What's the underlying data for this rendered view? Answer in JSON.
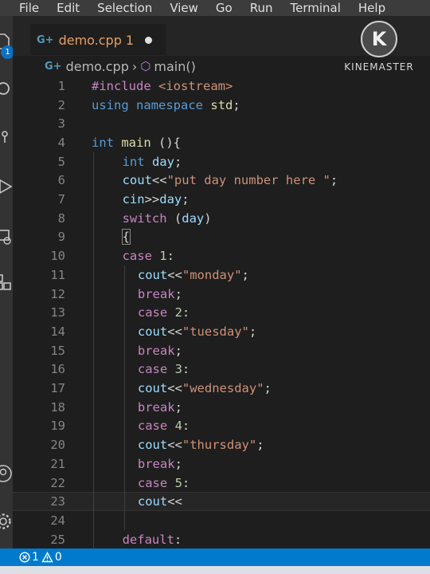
{
  "menu": [
    "File",
    "Edit",
    "Selection",
    "View",
    "Go",
    "Run",
    "Terminal",
    "Help"
  ],
  "tab": {
    "filename": "demo.cpp",
    "modified_count": "1"
  },
  "breadcrumb": {
    "file": "demo.cpp",
    "symbol": "main()"
  },
  "activity": {
    "badge": "1"
  },
  "watermark": {
    "letter": "K",
    "text": "KINEMASTER"
  },
  "status": {
    "errors": "1",
    "warnings": "0"
  },
  "editor": {
    "current_line": 23,
    "lines": [
      {
        "n": "1",
        "indent": 0,
        "tokens": [
          [
            "pp",
            "#include "
          ],
          [
            "inc",
            "<iostream>"
          ]
        ]
      },
      {
        "n": "2",
        "indent": 0,
        "tokens": [
          [
            "kw",
            "using"
          ],
          [
            "plain",
            " "
          ],
          [
            "kw",
            "namespace"
          ],
          [
            "plain",
            " "
          ],
          [
            "fn",
            "std"
          ],
          [
            "plain",
            ";"
          ]
        ]
      },
      {
        "n": "3",
        "indent": 0,
        "tokens": []
      },
      {
        "n": "4",
        "indent": 0,
        "tokens": [
          [
            "kw",
            "int"
          ],
          [
            "plain",
            " "
          ],
          [
            "fn",
            "main"
          ],
          [
            "plain",
            " (){"
          ]
        ]
      },
      {
        "n": "5",
        "indent": 2,
        "tokens": [
          [
            "kw",
            "int"
          ],
          [
            "plain",
            " "
          ],
          [
            "id",
            "day"
          ],
          [
            "plain",
            ";"
          ]
        ]
      },
      {
        "n": "6",
        "indent": 2,
        "tokens": [
          [
            "id",
            "cout"
          ],
          [
            "plain",
            "<<"
          ],
          [
            "str",
            "\"put day number here \""
          ],
          [
            "plain",
            ";"
          ]
        ]
      },
      {
        "n": "7",
        "indent": 2,
        "tokens": [
          [
            "id",
            "cin"
          ],
          [
            "plain",
            ">>"
          ],
          [
            "id",
            "day"
          ],
          [
            "plain",
            ";"
          ]
        ]
      },
      {
        "n": "8",
        "indent": 2,
        "tokens": [
          [
            "ctl",
            "switch"
          ],
          [
            "plain",
            " ("
          ],
          [
            "id",
            "day"
          ],
          [
            "plain",
            ")"
          ]
        ]
      },
      {
        "n": "9",
        "indent": 2,
        "tokens": [
          [
            "plain",
            "{"
          ]
        ]
      },
      {
        "n": "10",
        "indent": 2,
        "tokens": [
          [
            "ctl",
            "case"
          ],
          [
            "plain",
            " "
          ],
          [
            "num",
            "1"
          ],
          [
            "plain",
            ":"
          ]
        ]
      },
      {
        "n": "11",
        "indent": 3,
        "tokens": [
          [
            "id",
            "cout"
          ],
          [
            "plain",
            "<<"
          ],
          [
            "str",
            "\"monday\""
          ],
          [
            "plain",
            ";"
          ]
        ]
      },
      {
        "n": "12",
        "indent": 3,
        "tokens": [
          [
            "ctl",
            "break"
          ],
          [
            "plain",
            ";"
          ]
        ]
      },
      {
        "n": "13",
        "indent": 3,
        "tokens": [
          [
            "ctl",
            "case"
          ],
          [
            "plain",
            " "
          ],
          [
            "num",
            "2"
          ],
          [
            "plain",
            ":"
          ]
        ]
      },
      {
        "n": "14",
        "indent": 3,
        "tokens": [
          [
            "id",
            "cout"
          ],
          [
            "plain",
            "<<"
          ],
          [
            "str",
            "\"tuesday\""
          ],
          [
            "plain",
            ";"
          ]
        ]
      },
      {
        "n": "15",
        "indent": 3,
        "tokens": [
          [
            "ctl",
            "break"
          ],
          [
            "plain",
            ";"
          ]
        ]
      },
      {
        "n": "16",
        "indent": 3,
        "tokens": [
          [
            "ctl",
            "case"
          ],
          [
            "plain",
            " "
          ],
          [
            "num",
            "3"
          ],
          [
            "plain",
            ":"
          ]
        ]
      },
      {
        "n": "17",
        "indent": 3,
        "tokens": [
          [
            "id",
            "cout"
          ],
          [
            "plain",
            "<<"
          ],
          [
            "str",
            "\"wednesday\""
          ],
          [
            "plain",
            ";"
          ]
        ]
      },
      {
        "n": "18",
        "indent": 3,
        "tokens": [
          [
            "ctl",
            "break"
          ],
          [
            "plain",
            ";"
          ]
        ]
      },
      {
        "n": "19",
        "indent": 3,
        "tokens": [
          [
            "ctl",
            "case"
          ],
          [
            "plain",
            " "
          ],
          [
            "num",
            "4"
          ],
          [
            "plain",
            ":"
          ]
        ]
      },
      {
        "n": "20",
        "indent": 3,
        "tokens": [
          [
            "id",
            "cout"
          ],
          [
            "plain",
            "<<"
          ],
          [
            "str",
            "\"thursday\""
          ],
          [
            "plain",
            ";"
          ]
        ]
      },
      {
        "n": "21",
        "indent": 3,
        "tokens": [
          [
            "ctl",
            "break"
          ],
          [
            "plain",
            ";"
          ]
        ]
      },
      {
        "n": "22",
        "indent": 3,
        "tokens": [
          [
            "ctl",
            "case"
          ],
          [
            "plain",
            " "
          ],
          [
            "num",
            "5"
          ],
          [
            "plain",
            ":"
          ]
        ]
      },
      {
        "n": "23",
        "indent": 3,
        "tokens": [
          [
            "id",
            "cout"
          ],
          [
            "plain",
            "<<"
          ]
        ]
      },
      {
        "n": "24",
        "indent": 0,
        "tokens": []
      },
      {
        "n": "25",
        "indent": 2,
        "tokens": [
          [
            "ctl",
            "default"
          ],
          [
            "plain",
            ":"
          ]
        ]
      }
    ]
  }
}
